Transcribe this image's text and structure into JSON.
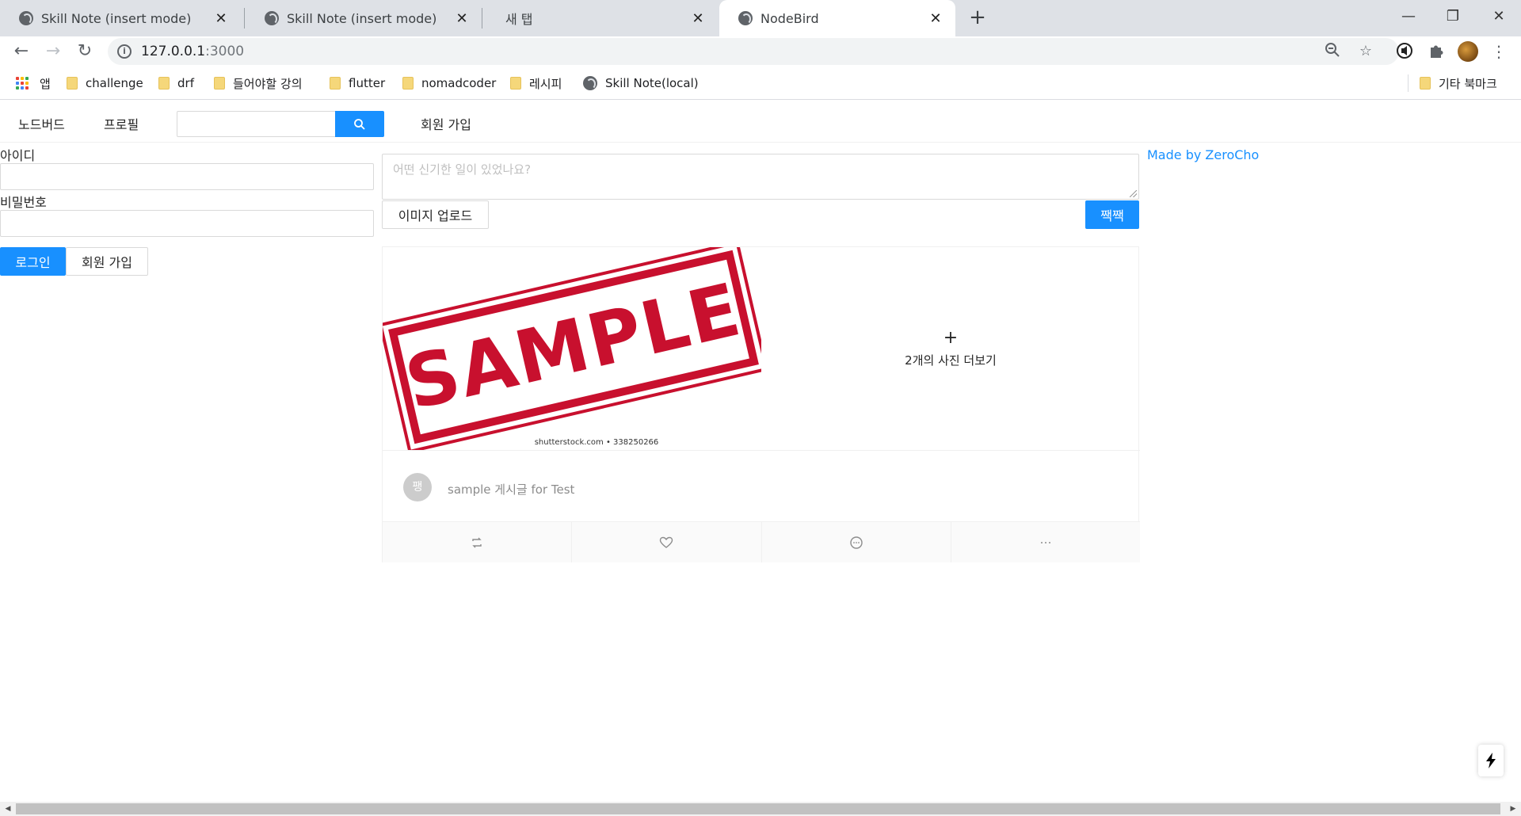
{
  "browser": {
    "tabs": [
      {
        "title": "Skill Note (insert mode)",
        "favicon": "globe-icon"
      },
      {
        "title": "Skill Note (insert mode)",
        "favicon": "globe-icon"
      },
      {
        "title": "새 탭",
        "favicon": ""
      },
      {
        "title": "NodeBird",
        "favicon": "globe-icon",
        "active": true
      }
    ],
    "new_tab_label": "+",
    "address": {
      "host": "127.0.0.1",
      "port": ":3000"
    },
    "bookmarks": [
      {
        "label": "앱",
        "icon": "apps-grid-icon"
      },
      {
        "label": "challenge",
        "icon": "folder-icon"
      },
      {
        "label": "drf",
        "icon": "folder-icon"
      },
      {
        "label": "들어야할 강의",
        "icon": "folder-icon"
      },
      {
        "label": "flutter",
        "icon": "folder-icon"
      },
      {
        "label": "nomadcoder",
        "icon": "folder-icon"
      },
      {
        "label": "레시피",
        "icon": "folder-icon"
      },
      {
        "label": "Skill Note(local)",
        "icon": "globe-icon"
      }
    ],
    "other_bookmarks": "기타 북마크"
  },
  "nav": {
    "home": "노드버드",
    "profile": "프로필",
    "signup": "회원 가입",
    "search_value": ""
  },
  "login": {
    "id_label": "아이디",
    "password_label": "비밀번호",
    "id_value": "",
    "password_value": "",
    "login_button": "로그인",
    "signup_button": "회원 가입"
  },
  "post_form": {
    "placeholder": "어떤 신기한 일이 있었나요?",
    "upload_button": "이미지 업로드",
    "submit_button": "짹짹"
  },
  "post": {
    "image_text": "SAMPLE",
    "image_credit": "shutterstock.com • 338250266",
    "more_photos": "2개의 사진 더보기",
    "more_plus": "+",
    "avatar_letter": "팽",
    "description": "sample 게시글 for Test",
    "actions": [
      "retweet-icon",
      "heart-icon",
      "message-icon",
      "ellipsis-icon"
    ]
  },
  "sidebar": {
    "credit": "Made by ZeroCho"
  },
  "colors": {
    "primary": "#1890ff",
    "stamp_red": "#c8102e"
  }
}
